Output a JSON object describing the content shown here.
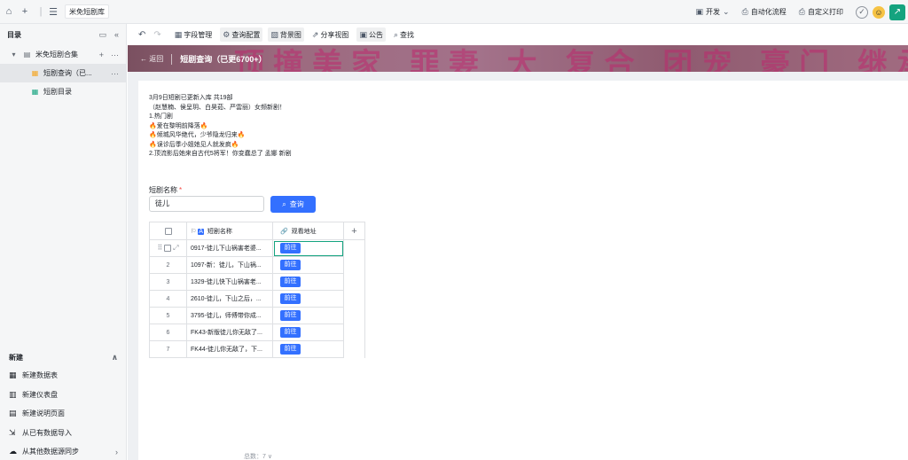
{
  "topbar": {
    "breadcrumb": "米免短剧库",
    "links": [
      {
        "icon": "dev-icon",
        "label": "开发"
      },
      {
        "icon": "automation-icon",
        "label": "自动化流程"
      },
      {
        "icon": "print-icon",
        "label": "自定义打印"
      }
    ]
  },
  "sidebar": {
    "title": "目录",
    "root": "米免短剧合集",
    "items": [
      {
        "label": "短剧查询（已...",
        "icon": "form-icon",
        "active": true
      },
      {
        "label": "短剧目录",
        "icon": "table-icon",
        "active": false
      }
    ],
    "create": {
      "title": "新建",
      "items": [
        {
          "label": "新建数据表",
          "icon": "table-icon"
        },
        {
          "label": "新建仪表盘",
          "icon": "dashboard-icon"
        },
        {
          "label": "新建说明页面",
          "icon": "doc-icon"
        },
        {
          "label": "从已有数据导入",
          "icon": "import-icon"
        },
        {
          "label": "从其他数据源同步",
          "icon": "sync-icon"
        }
      ]
    }
  },
  "toolbar": {
    "items": [
      {
        "label": "字段管理",
        "icon": "field-icon",
        "boxed": false
      },
      {
        "label": "查询配置",
        "icon": "settings-icon",
        "boxed": true
      },
      {
        "label": "背景图",
        "icon": "image-icon",
        "boxed": true
      },
      {
        "label": "分享视图",
        "icon": "share-icon",
        "boxed": false
      },
      {
        "label": "公告",
        "icon": "announcement-icon",
        "boxed": true
      },
      {
        "label": "查找",
        "icon": "search-icon",
        "boxed": false
      }
    ]
  },
  "banner": {
    "back": "← 返回",
    "title": "短剧查询（已更6700+）",
    "decoration": "顶撞美家 罪妻 大 复合 团宠 豪门 继承 爱上你 闪婚"
  },
  "notice": [
    "3月9日短剧已更新入库 共19部",
    "（赵慧楠、侯呈玥、白昊茹、严雲丽）女频新剧！",
    "1.热门剧",
    "🔥爱在黎明前降落🔥",
    "🔥倾城风华绝代，少爷隐龙归来🔥",
    "🔥误诊后季小姐她见人就发疯🔥",
    "2.顶流影后她来自古代5将军！你变蠢总了 孟娜 新剧"
  ],
  "query": {
    "field_label": "短剧名称",
    "required_mark": "*",
    "input_value": "徒儿",
    "button_label": "查询"
  },
  "table": {
    "col_name": "短剧名称",
    "col_url": "观看地址",
    "go_label": "前往",
    "rows": [
      {
        "index": "1",
        "name": "0917-徒儿下山祸害老婆..."
      },
      {
        "index": "2",
        "name": "1097-新：徒儿，下山祸..."
      },
      {
        "index": "3",
        "name": "1329-徒儿快下山祸害老..."
      },
      {
        "index": "4",
        "name": "2610-徒儿，下山之后，..."
      },
      {
        "index": "5",
        "name": "3795-徒儿，师傅带你成..."
      },
      {
        "index": "6",
        "name": "FK43-新版徒儿你无敌了..."
      },
      {
        "index": "7",
        "name": "FK44-徒儿你无敌了，下..."
      }
    ]
  },
  "footer": "总数：7 ∨"
}
